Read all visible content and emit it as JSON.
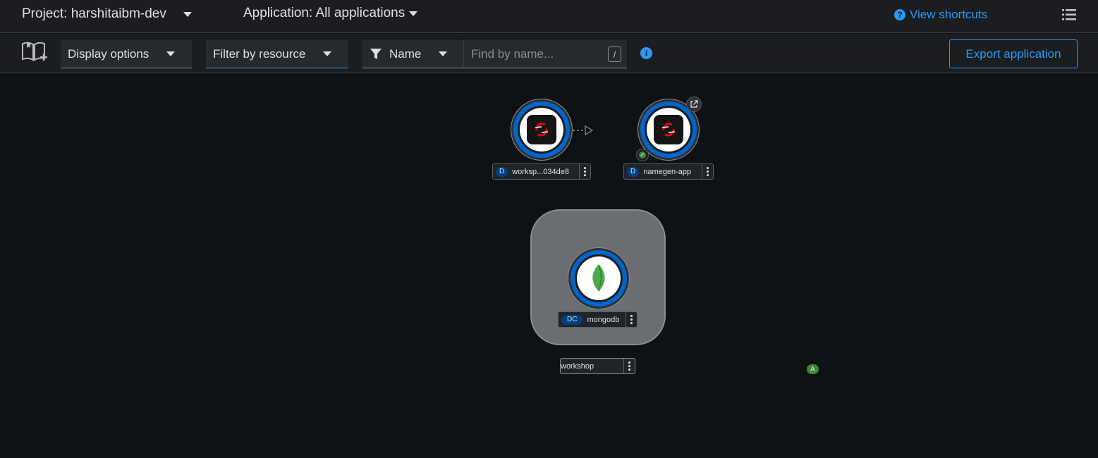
{
  "header": {
    "project_label": "Project: harshitaibm-dev",
    "application_label": "Application: All applications",
    "shortcuts_label": "View shortcuts",
    "shortcuts_icon": "question-circle-icon",
    "view_toggle_icon": "list-view-icon"
  },
  "toolbar": {
    "add_icon": "quick-starts-book-icon",
    "display_options": "Display options",
    "filter_by_resource": "Filter by resource",
    "name_filter": "Name",
    "search_placeholder": "Find by name...",
    "search_shortcut": "/",
    "info_icon": "info-circle-icon",
    "export_label": "Export application"
  },
  "topology": {
    "nodes": [
      {
        "badge": "D",
        "name": "worksp...034de8",
        "icon": "openshift-icon"
      },
      {
        "badge": "D",
        "name": "namegen-app",
        "icon": "openshift-icon",
        "status": "success"
      },
      {
        "badge": "DC",
        "name": "mongodb",
        "icon": "mongodb-leaf-icon"
      }
    ],
    "application_group": {
      "badge": "A",
      "name": "workshop"
    }
  },
  "colors": {
    "accent": "#2b9af3",
    "ring": "#0066cc",
    "badge_deploy": "#004080",
    "badge_app": "#3e8635",
    "group_bg": "#6a6e73"
  }
}
